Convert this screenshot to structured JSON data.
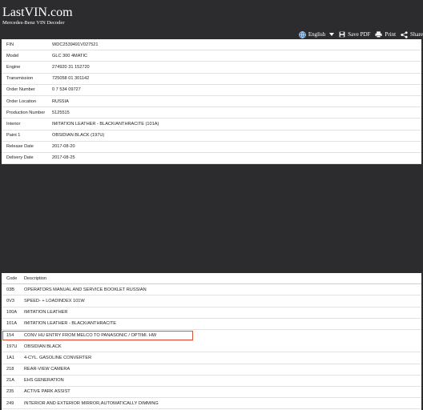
{
  "header": {
    "logo": "LastVIN.com",
    "subtitle": "Mercedes-Benz VIN Decoder",
    "actions": {
      "language": "English",
      "save_pdf": "Save PDF",
      "print": "Print",
      "share": "Share"
    }
  },
  "vehicle_info": [
    {
      "label": "FIN",
      "value": "WDC2539491V027521"
    },
    {
      "label": "Model",
      "value": "GLC 300 4MATIC"
    },
    {
      "label": "Engine",
      "value": "274920 31 152720"
    },
    {
      "label": "Transmission",
      "value": "725058 01 301142"
    },
    {
      "label": "Order Number",
      "value": "0 7 534 09727"
    },
    {
      "label": "Order Location",
      "value": "RUSSIA"
    },
    {
      "label": "Production Number",
      "value": "5125515"
    },
    {
      "label": "Interior",
      "value": "IMITATION LEATHER - BLACK/ANTHRACITE (101A)"
    },
    {
      "label": "Paint 1",
      "value": "OBSIDIAN BLACK (197U)"
    },
    {
      "label": "Release Date",
      "value": "2017-08-20"
    },
    {
      "label": "Delivery Date",
      "value": "2017-08-25"
    }
  ],
  "options_table": {
    "headers": {
      "code": "Code",
      "description": "Description"
    },
    "highlight_color": "#d9533a",
    "rows": [
      {
        "code": "03B",
        "description": "OPERATORS MANUAL AND SERVICE BOOKLET RUSSIAN"
      },
      {
        "code": "0V3",
        "description": "SPEED- + LOADINDEX 101W"
      },
      {
        "code": "100A",
        "description": "IMITATION LEATHER"
      },
      {
        "code": "101A",
        "description": "IMITATION LEATHER - BLACK/ANTHRACITE"
      },
      {
        "code": "154",
        "description": "CONV HU ENTRY FROM MELCO TO PANASONIC / OPTIMI. HW",
        "highlighted": true
      },
      {
        "code": "197U",
        "description": "OBSIDIAN BLACK"
      },
      {
        "code": "1A1",
        "description": "4-CYL. GASOLINE CONVERTER"
      },
      {
        "code": "218",
        "description": "REAR-VIEW CAMERA"
      },
      {
        "code": "21A",
        "description": "EHS GENERATION"
      },
      {
        "code": "235",
        "description": "ACTIVE PARK ASSIST"
      },
      {
        "code": "249",
        "description": "INTERIOR AND EXTERIOR MIRROR,AUTOMATICALLY DIMMING"
      }
    ]
  }
}
